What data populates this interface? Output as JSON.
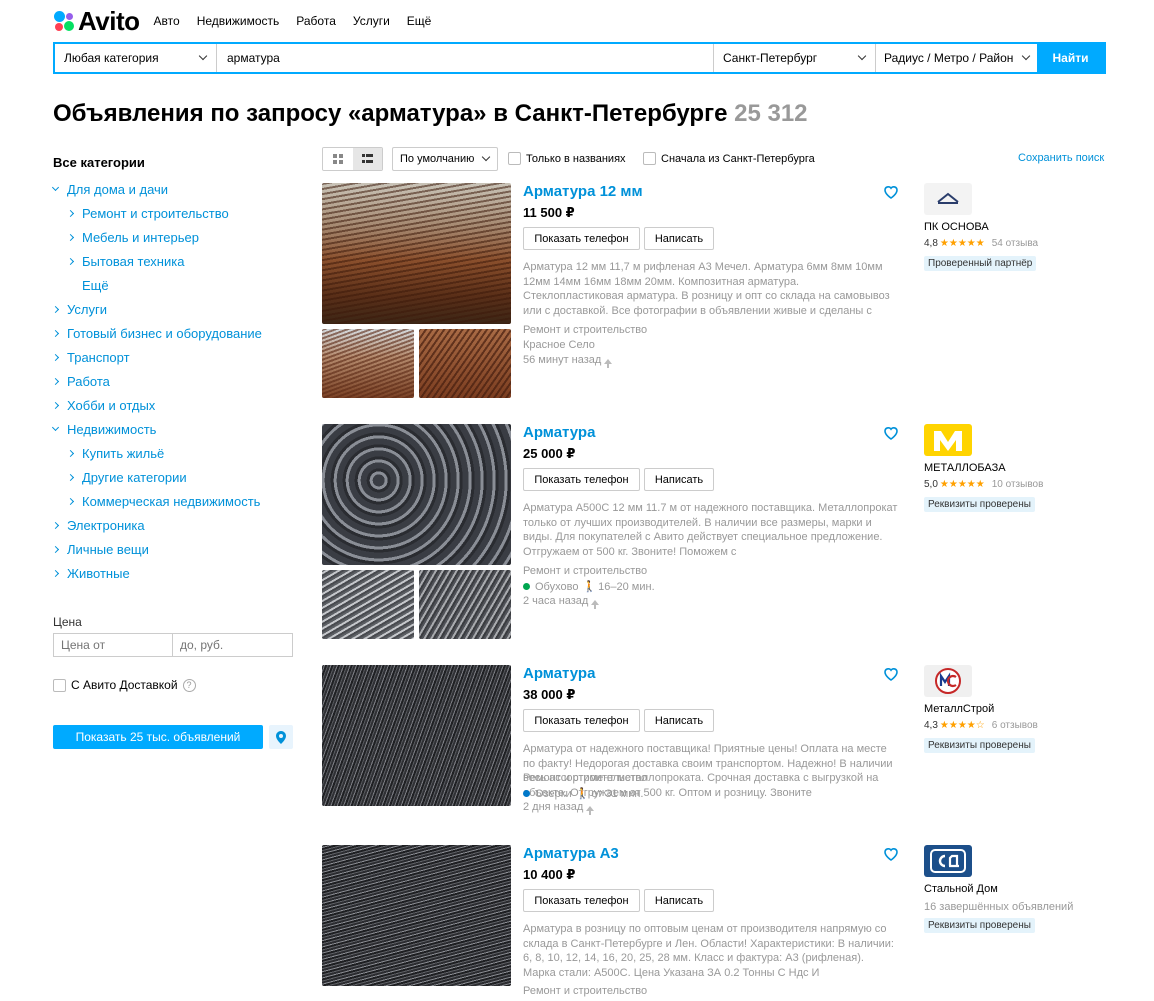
{
  "header": {
    "logo": "Avito",
    "nav": [
      "Авто",
      "Недвижимость",
      "Работа",
      "Услуги",
      "Ещё"
    ]
  },
  "search": {
    "category": "Любая категория",
    "query": "арматура",
    "city": "Санкт-Петербург",
    "radius": "Радиус / Метро / Район",
    "button": "Найти"
  },
  "page": {
    "title": "Объявления по запросу «арматура» в Санкт-Петербурге",
    "count": "25 312"
  },
  "sidebar": {
    "all_categories": "Все категории",
    "items": [
      {
        "label": "Для дома и дачи",
        "level": 1,
        "expanded": true
      },
      {
        "label": "Ремонт и строительство",
        "level": 2
      },
      {
        "label": "Мебель и интерьер",
        "level": 2
      },
      {
        "label": "Бытовая техника",
        "level": 2
      },
      {
        "label": "Ещё",
        "level": 3
      },
      {
        "label": "Услуги",
        "level": 1
      },
      {
        "label": "Готовый бизнес и оборудование",
        "level": 1
      },
      {
        "label": "Транспорт",
        "level": 1
      },
      {
        "label": "Работа",
        "level": 1
      },
      {
        "label": "Хобби и отдых",
        "level": 1
      },
      {
        "label": "Недвижимость",
        "level": 1,
        "expanded": true
      },
      {
        "label": "Купить жильё",
        "level": 2
      },
      {
        "label": "Другие категории",
        "level": 2
      },
      {
        "label": "Коммерческая недвижимость",
        "level": 2
      },
      {
        "label": "Электроника",
        "level": 1
      },
      {
        "label": "Личные вещи",
        "level": 1
      },
      {
        "label": "Животные",
        "level": 1
      }
    ],
    "price_label": "Цена",
    "price_from_placeholder": "Цена от",
    "price_to_placeholder": "до, руб.",
    "delivery_label": "С Авито Доставкой",
    "show_button": "Показать 25 тыс. объявлений"
  },
  "toolbar": {
    "sort": "По умолчанию",
    "only_titles": "Только в названиях",
    "city_first": "Сначала из Санкт-Петербурга",
    "save_search": "Сохранить поиск"
  },
  "buttons": {
    "phone": "Показать телефон",
    "write": "Написать"
  },
  "listings": [
    {
      "title": "Арматура 12 мм",
      "price": "11 500 ₽",
      "description": "Арматура 12 мм 11,7 м рифленая А3 Мечел. Арматура 6мм 8мм 10мм 12мм 14мм 16мм 18мм 20мм. Композитная арматура. Стеклопластиковая арматура. В розницу и опт со склада на самовывоз или с доставкой. Все фотографии в объявлении живые и сделаны с",
      "category": "Ремонт и строительство",
      "location": "Красное Село",
      "time": "56 минут назад",
      "seller": {
        "name": "ПК ОСНОВА",
        "rating": "4,8",
        "stars": "★★★★★",
        "reviews": "54 отзыва",
        "badge": "Проверенный партнёр"
      }
    },
    {
      "title": "Арматура",
      "price": "25 000 ₽",
      "description": "Арматура А500С 12 мм 11.7 м от надежного поставщика. Металлопрокат только от лучших производителей. В наличии все размеры, марки и виды. Для покупателей с Авито действует специальное предложение. Отгружаем от 500 кг. Звоните! Поможем с",
      "category": "Ремонт и строительство",
      "location": "Обухово",
      "walk": "16–20 мин.",
      "metro_color": "#00a650",
      "time": "2 часа назад",
      "seller": {
        "name": "МЕТАЛЛОБАЗА",
        "rating": "5,0",
        "stars": "★★★★★",
        "reviews": "10 отзывов",
        "badge": "Реквизиты проверены"
      }
    },
    {
      "title": "Арматура",
      "price": "38 000 ₽",
      "description": "Арматура от надежного поставщика! Приятные цены! Оплата на месте по факту! Недорогая доставка своим транспортом. Надежно! В наличии весь ассортимент металлопроката. Срочная доставка с выгрузкой на объекте. Отгружаем от 500 кг. Оптом и розницу. Звоните",
      "category": "Ремонт и строительство",
      "location": "Озерки",
      "walk": "от 31 мин.",
      "metro_color": "#0078c9",
      "time": "2 дня назад",
      "seller": {
        "name": "МеталлСтрой",
        "rating": "4,3",
        "stars": "★★★★☆",
        "reviews": "6 отзывов",
        "badge": "Реквизиты проверены"
      }
    },
    {
      "title": "Арматура А3",
      "price": "10 400 ₽",
      "description": "Арматура в розницу по оптовым ценам от производителя напрямую со склада в Санкт-Петербурге и Лен. Области! Характеристики: В наличии: 6, 8, 10, 12, 14, 16, 20, 25, 28 мм. Класс и фактура: А3 (рифленая). Марка стали: А500С. Цена Указана ЗА 0.2 Тонны С Ндс И",
      "category": "Ремонт и строительство",
      "seller": {
        "name": "Стальной Дом",
        "sub": "16 завершённых объявлений",
        "badge": "Реквизиты проверены"
      }
    }
  ],
  "colors": {
    "accent": "#00aaff",
    "link": "#0091d9",
    "star": "#ffa000",
    "badge_bg": "#e4f3fb"
  }
}
